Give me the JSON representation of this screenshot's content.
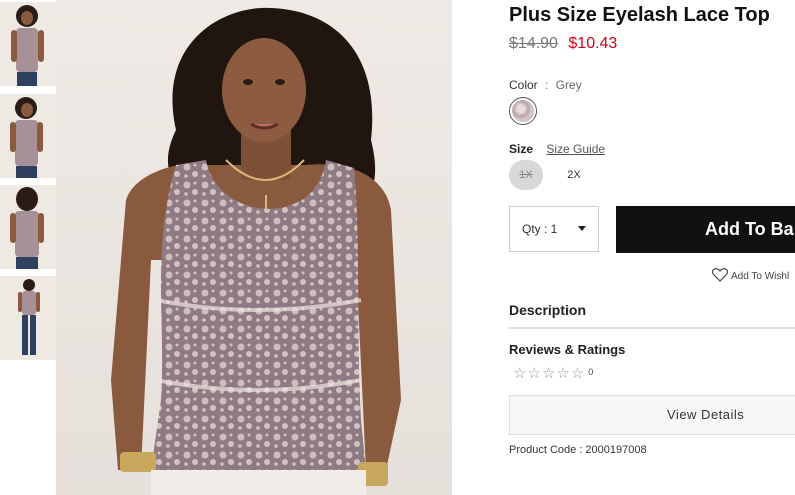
{
  "product": {
    "title": "Plus Size Eyelash Lace Top",
    "original_price": "$14.90",
    "sale_price": "$10.43",
    "product_code_label": "Product Code : 2000197008"
  },
  "color": {
    "label": "Color",
    "separator": ":",
    "selected": "Grey"
  },
  "size": {
    "label": "Size",
    "guide_link": "Size Guide",
    "options": [
      "1X",
      "2X"
    ]
  },
  "purchase": {
    "qty_label": "Qty : 1",
    "add_button": "Add To Ba",
    "wishlist": "Add To Wishl"
  },
  "sections": {
    "description": "Description",
    "reviews": "Reviews & Ratings",
    "stars": "☆☆☆☆☆",
    "review_count": "0",
    "view_details": "View Details"
  },
  "colors": {
    "sale": "#d0021b",
    "button": "#111111",
    "top_lace": "#8f7a84"
  }
}
